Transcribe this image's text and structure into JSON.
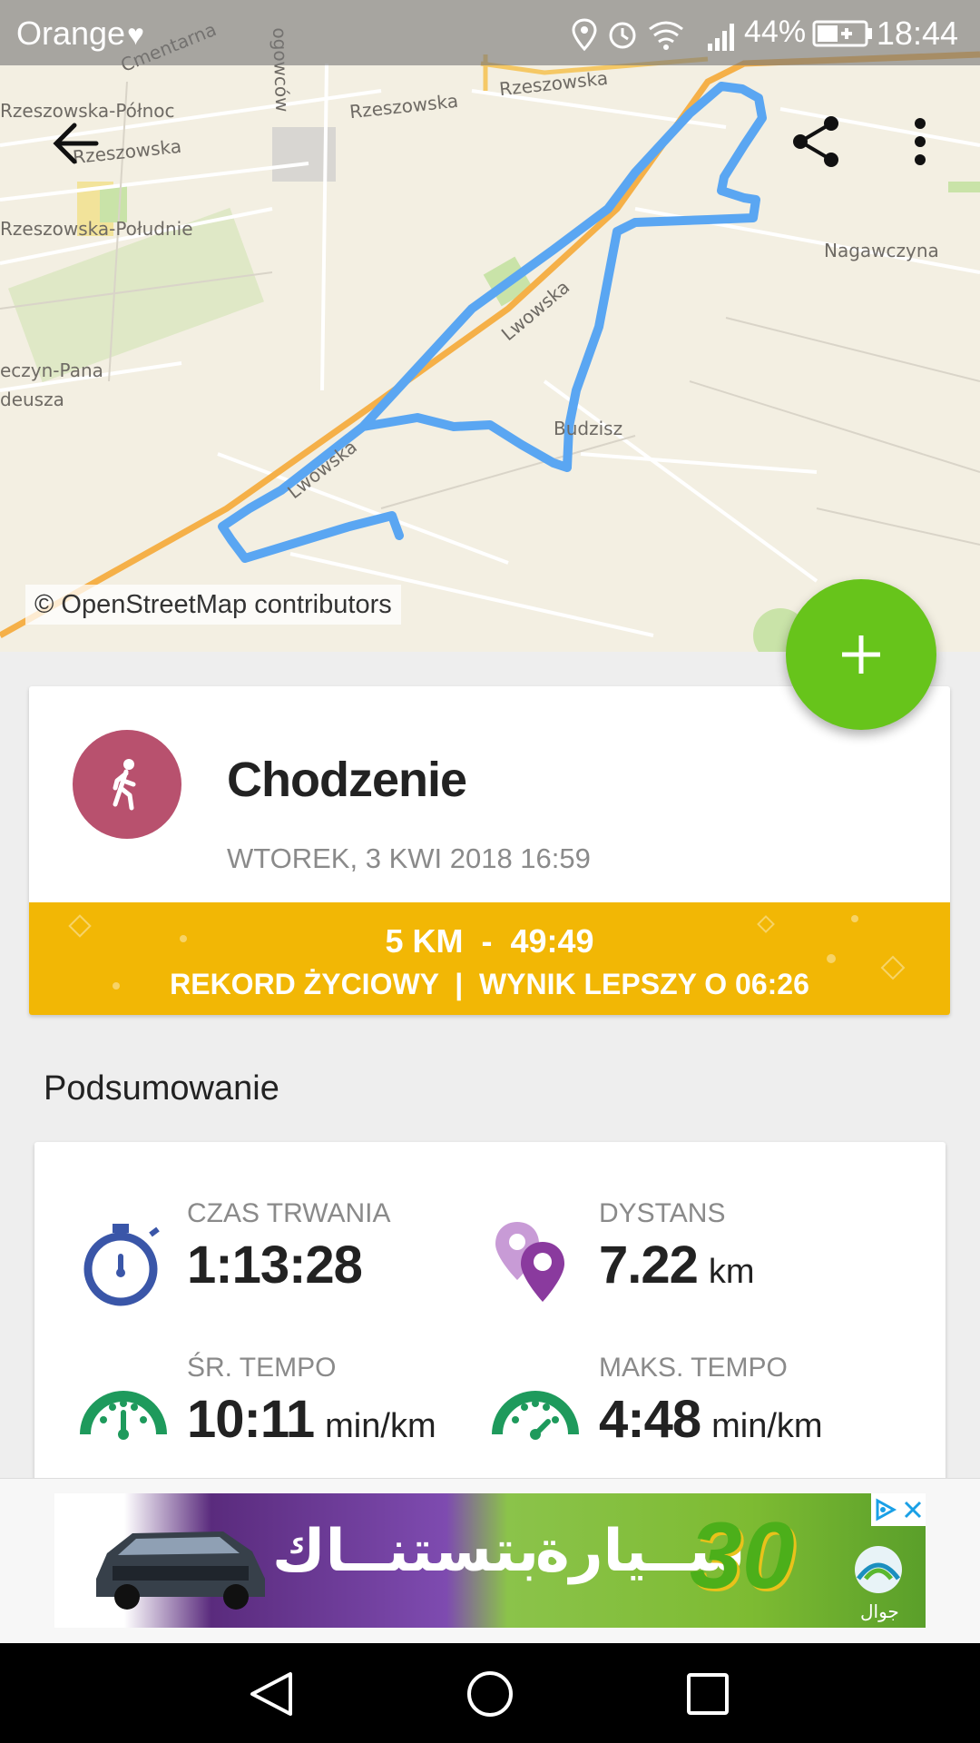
{
  "status_bar": {
    "carrier": "Orange",
    "battery": "44%",
    "time": "18:44"
  },
  "map": {
    "labels": {
      "rzeszowska_polnoc": "Rzeszowska-Północ",
      "rzeszowska_1": "Rzeszowska",
      "rzeszowska_2": "Rzeszowska",
      "rzeszowska_3": "Rzeszowska",
      "rzeszowska_poludnie": "Rzeszowska-Południe",
      "cmentarna": "Cmentarna",
      "ogowcow": "ogowców",
      "nagawczyna": "Nagawczyna",
      "lwowska_1": "Lwowska",
      "lwowska_2": "Lwowska",
      "budzisz": "Budzisz",
      "kaczyn_pana": "eczyn-Pana",
      "tadeusza": "deusza"
    },
    "attribution": "© OpenStreetMap contributors",
    "route_color": "#5aa6f2"
  },
  "toolbar": {
    "back_icon": "arrow-left-icon",
    "share_icon": "share-icon",
    "menu_icon": "more-vertical-icon"
  },
  "fab": {
    "icon": "plus-icon",
    "color": "#67c41b"
  },
  "activity": {
    "type": "Chodzenie",
    "date": "WTOREK, 3 KWI 2018 16:59",
    "icon": "walking-icon",
    "icon_color": "#b8516e",
    "record_line1": "5 KM  -  49:49",
    "record_line2": "REKORD ŻYCIOWY  |  WYNIK LEPSZY O 06:26",
    "record_color": "#f2b705"
  },
  "summary": {
    "title": "Podsumowanie",
    "stats": [
      {
        "label": "CZAS TRWANIA",
        "value": "1:13:28",
        "unit": "",
        "icon": "stopwatch-icon"
      },
      {
        "label": "DYSTANS",
        "value": "7.22",
        "unit": "km",
        "icon": "map-pins-icon"
      },
      {
        "label": "ŚR. TEMPO",
        "value": "10:11",
        "unit": "min/km",
        "icon": "speedometer-icon"
      },
      {
        "label": "MAKS. TEMPO",
        "value": "4:48",
        "unit": "min/km",
        "icon": "speedometer-icon"
      }
    ]
  },
  "ad": {
    "text_right": "ســيارة",
    "text_left": "بتستنــاك",
    "number": "30",
    "brand": "جوال"
  },
  "nav": {
    "back_icon": "nav-back-icon",
    "home_icon": "nav-home-icon",
    "recents_icon": "nav-recents-icon"
  }
}
